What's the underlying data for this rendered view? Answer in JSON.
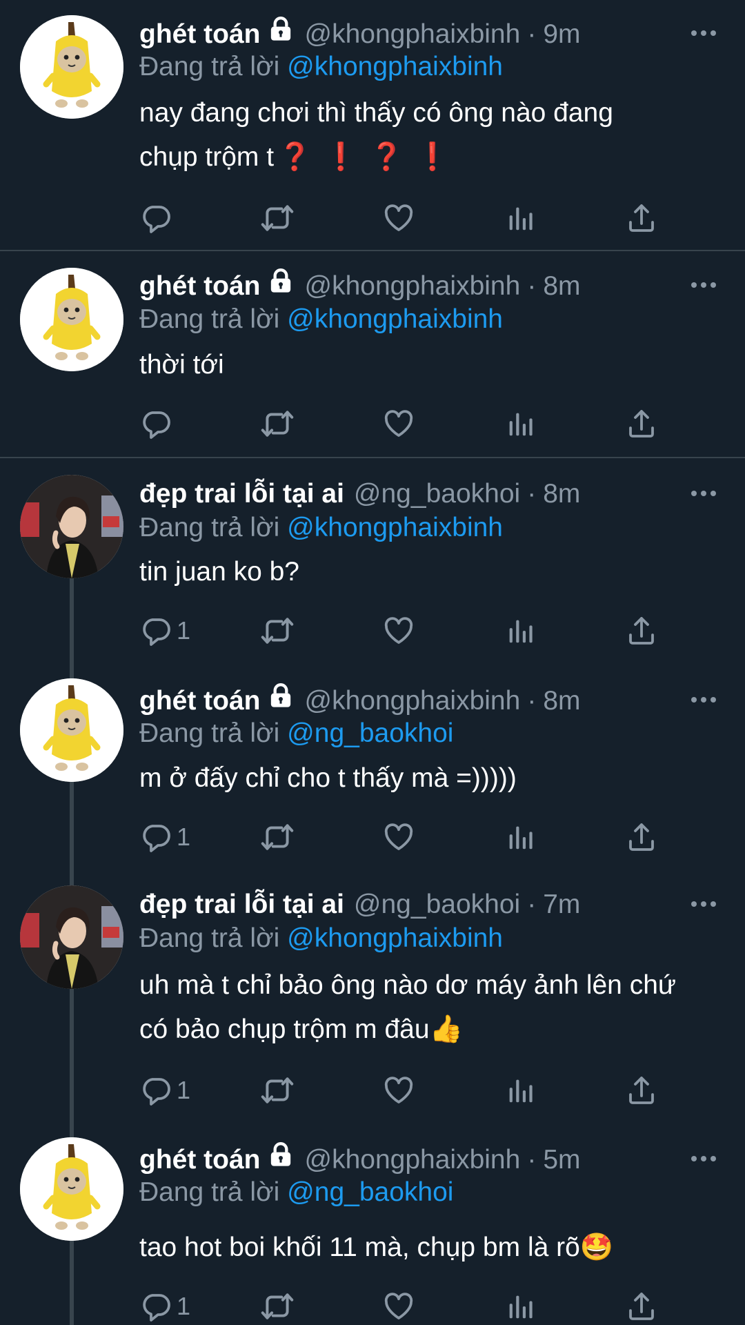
{
  "reply_prefix": "Đang trả lời",
  "tweets": [
    {
      "name": "ghét toán",
      "handle": "@khongphaixbinh",
      "dot": "·",
      "time": "9m",
      "reply_to": "@khongphaixbinh",
      "text_line1": "nay đang chơi thì thấy có ông nào đang",
      "text_line2": "chụp trộm t",
      "emphasis": "❓❗️❓❗️",
      "reply_count": ""
    },
    {
      "name": "ghét toán",
      "handle": "@khongphaixbinh",
      "dot": "·",
      "time": "8m",
      "reply_to": "@khongphaixbinh",
      "text": "thời tới",
      "reply_count": ""
    },
    {
      "name": "đẹp trai lỗi tại ai",
      "handle": "@ng_baokhoi",
      "dot": "·",
      "time": "8m",
      "reply_to": "@khongphaixbinh",
      "text": "tin juan ko b?",
      "reply_count": "1"
    },
    {
      "name": "ghét toán",
      "handle": "@khongphaixbinh",
      "dot": "·",
      "time": "8m",
      "reply_to": "@ng_baokhoi",
      "text": "m ở đấy chỉ cho t thấy mà =)))))",
      "reply_count": "1"
    },
    {
      "name": "đẹp trai lỗi tại ai",
      "handle": "@ng_baokhoi",
      "dot": "·",
      "time": "7m",
      "reply_to": "@khongphaixbinh",
      "text_line1": "uh mà t chỉ bảo ông nào dơ máy ảnh lên chứ",
      "text_line2": "có bảo chụp trộm m đâu👍",
      "reply_count": "1"
    },
    {
      "name": "ghét toán",
      "handle": "@khongphaixbinh",
      "dot": "·",
      "time": "5m",
      "reply_to": "@ng_baokhoi",
      "text": "tao hot boi khối 11 mà, chụp bm là rõ🤩",
      "reply_count": "1"
    }
  ],
  "colors": {
    "background": "#15202b",
    "secondary_text": "#8b98a5",
    "mention": "#1d9bf0",
    "divider": "#38444d",
    "emphasis": "#e0302d"
  },
  "icons": [
    "lock-icon",
    "more-icon",
    "reply-icon",
    "retweet-icon",
    "like-icon",
    "analytics-icon",
    "share-icon"
  ]
}
